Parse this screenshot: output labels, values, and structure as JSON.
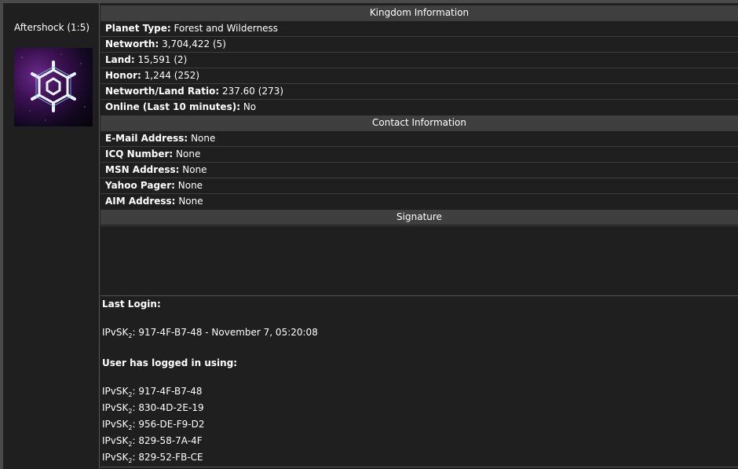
{
  "player": {
    "name": "Aftershock (1:5)"
  },
  "kingdom": {
    "header": "Kingdom Information",
    "rows": [
      {
        "label": "Planet Type:",
        "value": "Forest and Wilderness"
      },
      {
        "label": "Networth:",
        "value": "3,704,422 (5)"
      },
      {
        "label": "Land:",
        "value": "15,591 (2)"
      },
      {
        "label": "Honor:",
        "value": "1,244 (252)"
      },
      {
        "label": "Networth/Land Ratio:",
        "value": "237.60 (273)"
      },
      {
        "label": "Online (Last 10 minutes):",
        "value": "No"
      }
    ]
  },
  "contact": {
    "header": "Contact Information",
    "rows": [
      {
        "label": "E-Mail Address:",
        "value": "None"
      },
      {
        "label": "ICQ Number:",
        "value": "None"
      },
      {
        "label": "MSN Address:",
        "value": "None"
      },
      {
        "label": "Yahoo Pager:",
        "value": "None"
      },
      {
        "label": "AIM Address:",
        "value": "None"
      }
    ]
  },
  "signature": {
    "header": "Signature"
  },
  "login": {
    "last_login_label": "Last Login:",
    "last_login": {
      "prefix": "IPvSK",
      "sub": "2",
      "value": ": 917-4F-B7-48 - November 7, 05:20:08"
    },
    "history_label": "User has logged in using:",
    "history": [
      {
        "prefix": "IPvSK",
        "sub": "2",
        "value": ": 917-4F-B7-48"
      },
      {
        "prefix": "IPvSK",
        "sub": "2",
        "value": ": 830-4D-2E-19"
      },
      {
        "prefix": "IPvSK",
        "sub": "2",
        "value": ": 956-DE-F9-D2"
      },
      {
        "prefix": "IPvSK",
        "sub": "2",
        "value": ": 829-58-7A-4F"
      },
      {
        "prefix": "IPvSK",
        "sub": "2",
        "value": ": 829-52-FB-CE"
      }
    ]
  }
}
